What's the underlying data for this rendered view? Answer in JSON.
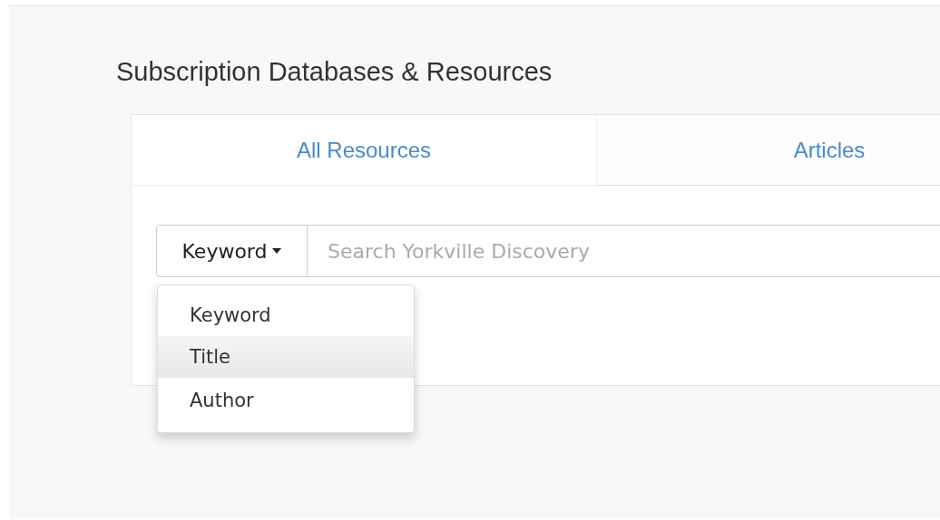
{
  "heading": "Subscription Databases & Resources",
  "tabs": [
    {
      "label": "All Resources",
      "selected": true
    },
    {
      "label": "Articles",
      "selected": false
    }
  ],
  "search": {
    "field_button": "Keyword",
    "placeholder": "Search Yorkville Discovery"
  },
  "dropdown": {
    "open": true,
    "items": [
      {
        "label": "Keyword",
        "selected": false
      },
      {
        "label": "Title",
        "selected": true
      },
      {
        "label": "Author",
        "selected": false
      }
    ]
  }
}
